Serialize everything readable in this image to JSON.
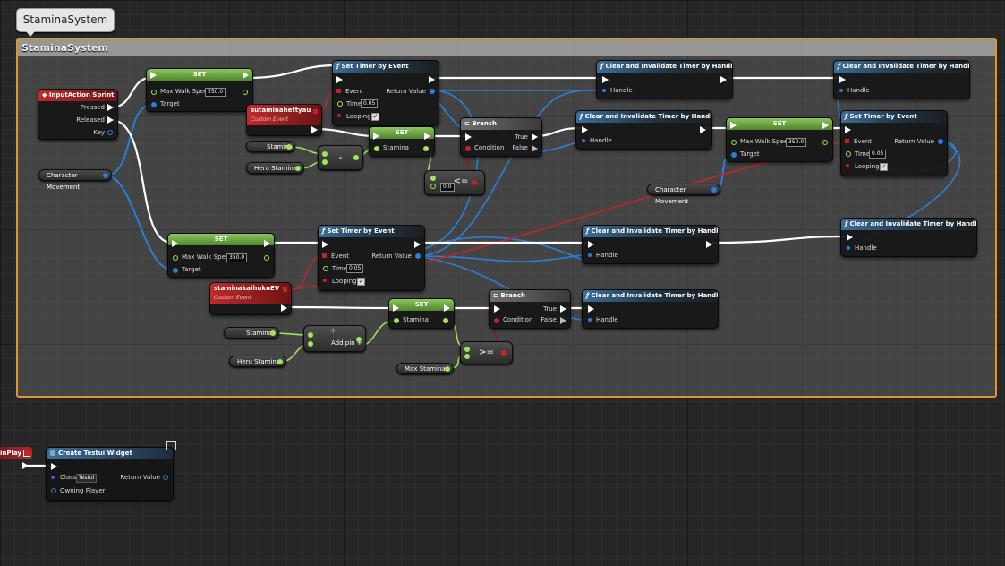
{
  "graph_bubble": "StaminaSystem",
  "comment_title": "StaminaSystem",
  "nodes": {
    "input_sprint": {
      "title": "InputAction Sprint",
      "pressed": "Pressed",
      "released": "Released",
      "key": "Key"
    },
    "char_move_1": {
      "label": "Character Movement"
    },
    "char_move_2": {
      "label": "Character Movement"
    },
    "set_speed_1": {
      "title": "SET",
      "field": "Max Walk Speed",
      "value": "550.0",
      "target": "Target"
    },
    "set_speed_2": {
      "title": "SET",
      "field": "Max Walk Speed",
      "value": "350.0",
      "target": "Target"
    },
    "set_speed_3": {
      "title": "SET",
      "field": "Max Walk Speed",
      "value": "350.0",
      "target": "Target"
    },
    "timer_1": {
      "title": "Set Timer by Event",
      "event": "Event",
      "return": "Return Value",
      "time": "Time",
      "time_value": "0.05",
      "looping": "Looping"
    },
    "timer_2": {
      "title": "Set Timer by Event",
      "event": "Event",
      "return": "Return Value",
      "time": "Time",
      "time_value": "0.05",
      "looping": "Looping"
    },
    "timer_3": {
      "title": "Set Timer by Event",
      "event": "Event",
      "return": "Return Value",
      "time": "Time",
      "time_value": "0.05",
      "looping": "Looping"
    },
    "event_1": {
      "title": "sutaminahettyau",
      "subtitle": "Custom Event"
    },
    "event_2": {
      "title": "staminakaihukuEV",
      "subtitle": "Custom Event"
    },
    "set_stamina_1": {
      "title": "SET",
      "field": "Stamina"
    },
    "set_stamina_2": {
      "title": "SET",
      "field": "Stamina"
    },
    "stamina_var_1": {
      "label": "Stamina"
    },
    "heru_var_1": {
      "label": "Heru Stamina"
    },
    "stamina_var_2": {
      "label": "Stamina"
    },
    "heru_var_2": {
      "label": "Heru Stamina"
    },
    "max_var": {
      "label": "Max Stamina"
    },
    "minus_op": {
      "symbol": "-"
    },
    "lte_op": {
      "symbol": "<=",
      "value": "0.0"
    },
    "gte_op": {
      "symbol": ">="
    },
    "add_op": {
      "symbol": "+",
      "addpin": "Add pin +"
    },
    "branch_1": {
      "title": "Branch",
      "condition": "Condition",
      "true_label": "True",
      "false_label": "False"
    },
    "branch_2": {
      "title": "Branch",
      "condition": "Condition",
      "true_label": "True",
      "false_label": "False"
    },
    "clear_1": {
      "title": "Clear and Invalidate Timer by Handle",
      "handle": "Handle"
    },
    "clear_2": {
      "title": "Clear and Invalidate Timer by Handle",
      "handle": "Handle"
    },
    "clear_3": {
      "title": "Clear and Invalidate Timer by Handle",
      "handle": "Handle"
    },
    "clear_4": {
      "title": "Clear and Invalidate Timer by Handle",
      "handle": "Handle"
    },
    "clear_5": {
      "title": "Clear and Invalidate Timer by Handle",
      "handle": "Handle"
    },
    "clear_6": {
      "title": "Clear and Invalidate Timer by Handle",
      "handle": "Handle"
    },
    "begin_play": {
      "label": "inPlay"
    },
    "create_widget": {
      "title": "Create Testui Widget",
      "class_label": "Class",
      "class_value": "Testui",
      "return": "Return Value",
      "owning": "Owning Player"
    }
  }
}
